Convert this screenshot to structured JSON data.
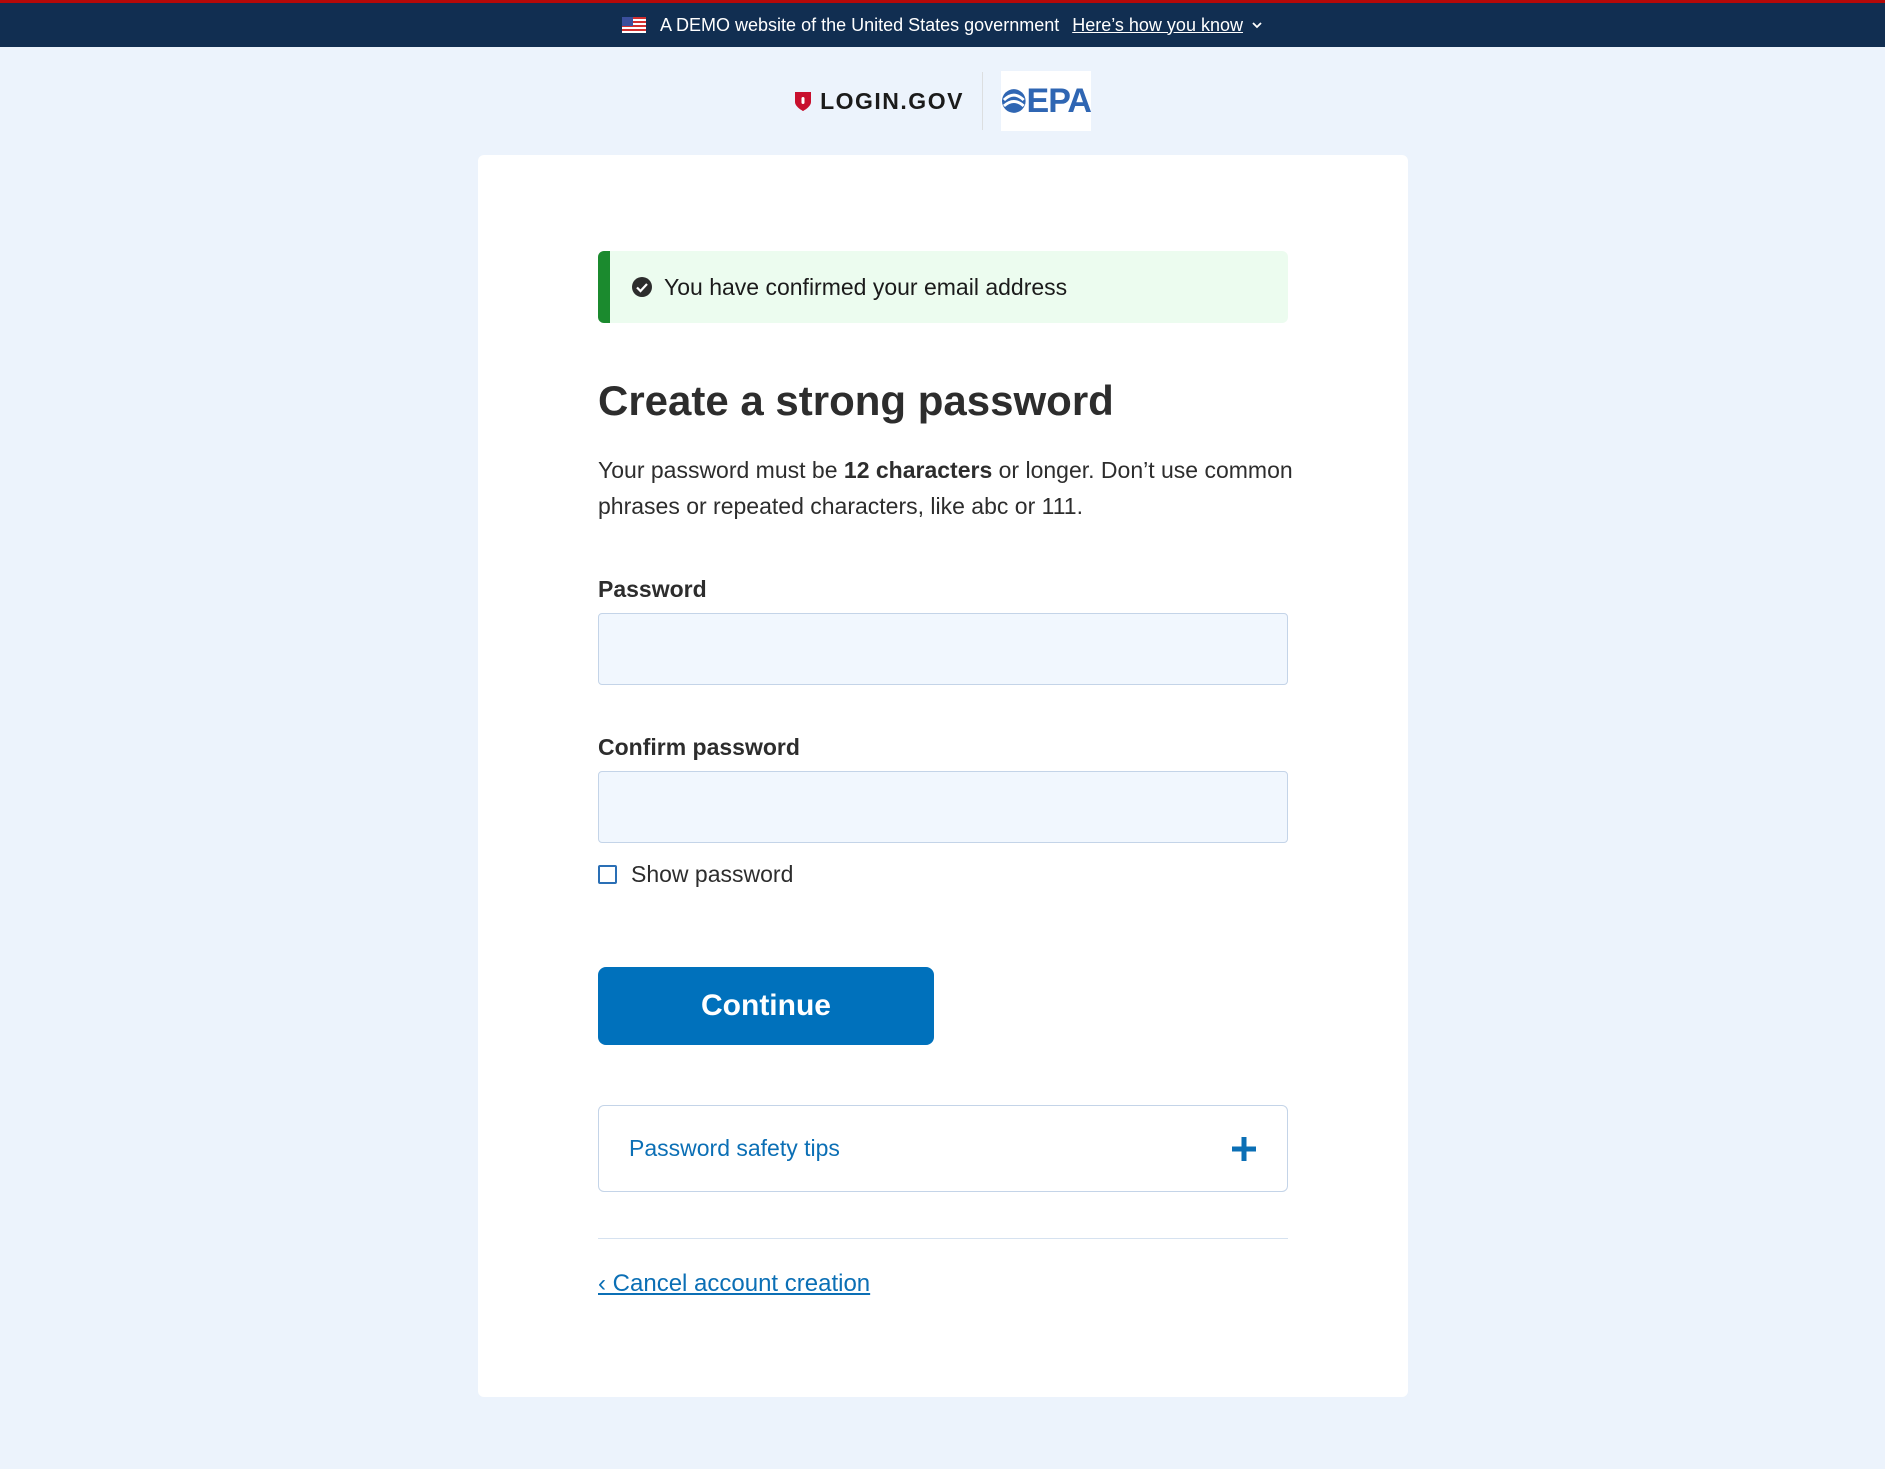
{
  "banner": {
    "text": "A DEMO website of the United States government",
    "link": "Here’s how you know"
  },
  "header": {
    "login_logo": "LOGIN.GOV",
    "partner_logo": "EPA"
  },
  "alert": {
    "message": "You have confirmed your email address"
  },
  "page": {
    "title": "Create a strong password",
    "intro_part1": "Your password must be ",
    "intro_bold": "12 characters",
    "intro_part2": " or longer. Don’t use common phrases or repeated characters, like abc or 111."
  },
  "form": {
    "password_label": "Password",
    "password_value": "",
    "confirm_label": "Confirm password",
    "confirm_value": "",
    "show_password_label": "Show password",
    "continue_label": "Continue"
  },
  "accordion": {
    "label": "Password safety tips"
  },
  "footer": {
    "cancel_label": "‹ Cancel account creation"
  },
  "colors": {
    "banner_bg": "#112e51",
    "primary": "#0071bc",
    "success": "#1b8a2e",
    "page_bg": "#ecf3fc"
  }
}
